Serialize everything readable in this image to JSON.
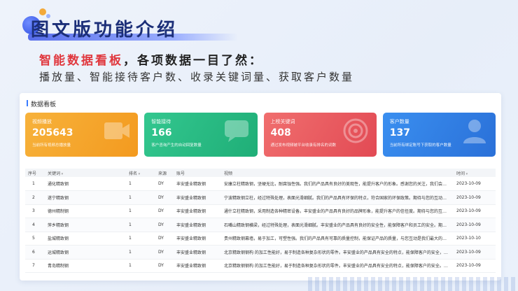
{
  "header": {
    "title": "图文版功能介绍",
    "subtitle_highlight": "智能数据看板",
    "subtitle_rest": "，各项数据一目了然：",
    "features": "播放量、智能接待客户数、收录关键词量、获取客户数量"
  },
  "dashboard": {
    "title": "数据看板",
    "cards": [
      {
        "label": "视频播放",
        "value": "205643",
        "desc": "当前所有视频总播放量"
      },
      {
        "label": "智能接待",
        "value": "166",
        "desc": "客户咨询产生的自动回复数量"
      },
      {
        "label": "上榜关键词",
        "value": "408",
        "desc": "通过发布视频被平台收录有排名的词数"
      },
      {
        "label": "客户数量",
        "value": "137",
        "desc": "当前所有绑定账号下获取的客户数量"
      }
    ],
    "columns": {
      "index": "序号",
      "keyword": "关键词",
      "rank": "排名",
      "source": "来源",
      "account": "账号",
      "video": "视频",
      "time": "时间"
    },
    "rows": [
      {
        "index": "1",
        "keyword": "通化精致钢",
        "rank": "1",
        "source": "DY",
        "account": "丰安盛业精致钢",
        "video": "安康立柱精致钢，坚硬无比，耐腐蚀性强。我们的产品具有良好的美观性，能提升客户的形象。感谢您的关注，我们会持续为...",
        "time": "2023-10-09"
      },
      {
        "index": "2",
        "keyword": "遂宁精致钢",
        "rank": "1",
        "source": "DY",
        "account": "丰安盛业精致钢",
        "video": "宁波精致钢立柱，经过特殊处理，表面光滑细腻。我们的产品具有环保的特点，符合国家的环保政策。期待与您的互动，分享...",
        "time": "2023-10-09"
      },
      {
        "index": "3",
        "keyword": "德州精制钢",
        "rank": "1",
        "source": "DY",
        "account": "丰安盛业精致钢",
        "video": "通什立柱精致钢，采用制造各种精密设备。丰安盛业的产品具有良好的品牌形象，能提升客户的信任度。期待与您的互动，分...",
        "time": "2023-10-09"
      },
      {
        "index": "4",
        "keyword": "萍乡精致钢",
        "rank": "1",
        "source": "DY",
        "account": "丰安盛业精致钢",
        "video": "石嘴山精致钢横梁，经过特殊处理，表面光滑细腻。丰安盛业的产品具有良好的安全性，能保障客户和员工的安全。期待与您...",
        "time": "2023-10-09"
      },
      {
        "index": "5",
        "keyword": "盐城精致钢",
        "rank": "1",
        "source": "DY",
        "account": "丰安盛业精致钢",
        "video": "贵州精致钢幕墙，易于加工，可塑性强。我们的产品具有可靠的质量控制，能保证产品的质量，与您互动是我们最大的乐趣，...",
        "time": "2023-10-10"
      },
      {
        "index": "6",
        "keyword": "运城精致钢",
        "rank": "1",
        "source": "DY",
        "account": "丰安盛业精致钢",
        "video": "北京精致钢钢构 的加工性能好，易于制造各种复杂形状的零件。丰安盛业的产品具有安全的特点，能保障客户的安全，感谢您...",
        "time": "2023-10-09"
      },
      {
        "index": "7",
        "keyword": "青岛精制钢",
        "rank": "1",
        "source": "DY",
        "account": "丰安盛业精致钢",
        "video": "北京精致钢钢构 的加工性能好，易于制造各种复杂形状的零件。丰安盛业的产品具有安全的特点，能保障客户的安全。感谢您的...",
        "time": "2023-10-09"
      }
    ]
  }
}
